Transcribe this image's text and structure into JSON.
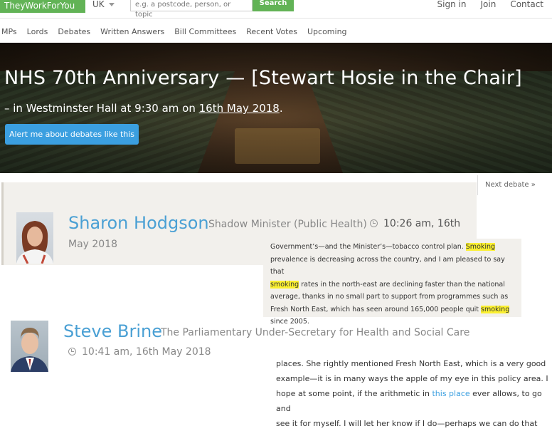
{
  "topbar": {
    "brand": "TheyWorkForYou",
    "country": "UK",
    "search_placeholder": "e.g. a postcode, person, or topic",
    "search_button": "Search",
    "links": [
      "Sign in",
      "Join",
      "Contact"
    ]
  },
  "nav": {
    "items": [
      "MPs",
      "Lords",
      "Debates",
      "Written Answers",
      "Bill Committees",
      "Recent Votes",
      "Upcoming"
    ]
  },
  "hero": {
    "title": "NHS 70th Anniversary — [Stewart Hosie in the Chair]",
    "subtitle_prefix": "– in Westminster Hall at 9:30 am on ",
    "subtitle_date": "16th May 2018",
    "subtitle_suffix": ".",
    "alert_button": "Alert me about debates like this"
  },
  "next_debate": "Next debate »",
  "speeches": [
    {
      "name": "Sharon Hodgson",
      "role": "Shadow Minister (Public Health)",
      "time": "10:26 am, 16th",
      "time_cont": "May 2018",
      "excerpt": {
        "line1_a": "Government’s—and the Minister’s—tobacco control plan. ",
        "line1_hl": "Smoking",
        "line2": "prevalence is decreasing across the country, and I am pleased to say that",
        "line3_hl": "smoking",
        "line3_b": " rates in the north-east are declining faster than the national",
        "line4": "average, thanks in no small part to support from programmes such as",
        "line5_a": "Fresh North East, which has seen around 165,000 people quit ",
        "line5_hl": "smoking",
        "line6": "since 2005."
      }
    },
    {
      "name": "Steve Brine",
      "role": "The Parliamentary Under-Secretary for Health and Social Care",
      "time": "10:41 am, 16th May 2018",
      "body": {
        "line1": "places. She rightly mentioned Fresh North East, which is a very good",
        "line2": "example—it is in many ways the apple of my eye in this policy area. I",
        "line3_a": "hope at some point, if the arithmetic in ",
        "line3_link": "this place",
        "line3_b": " ever allows, to go and",
        "line4": "see it for myself. I will let her know if I do—perhaps we can do that"
      }
    }
  ],
  "colors": {
    "brand_green": "#62b356",
    "link_blue": "#3b9fe0",
    "highlight_yellow": "#fbf031"
  }
}
